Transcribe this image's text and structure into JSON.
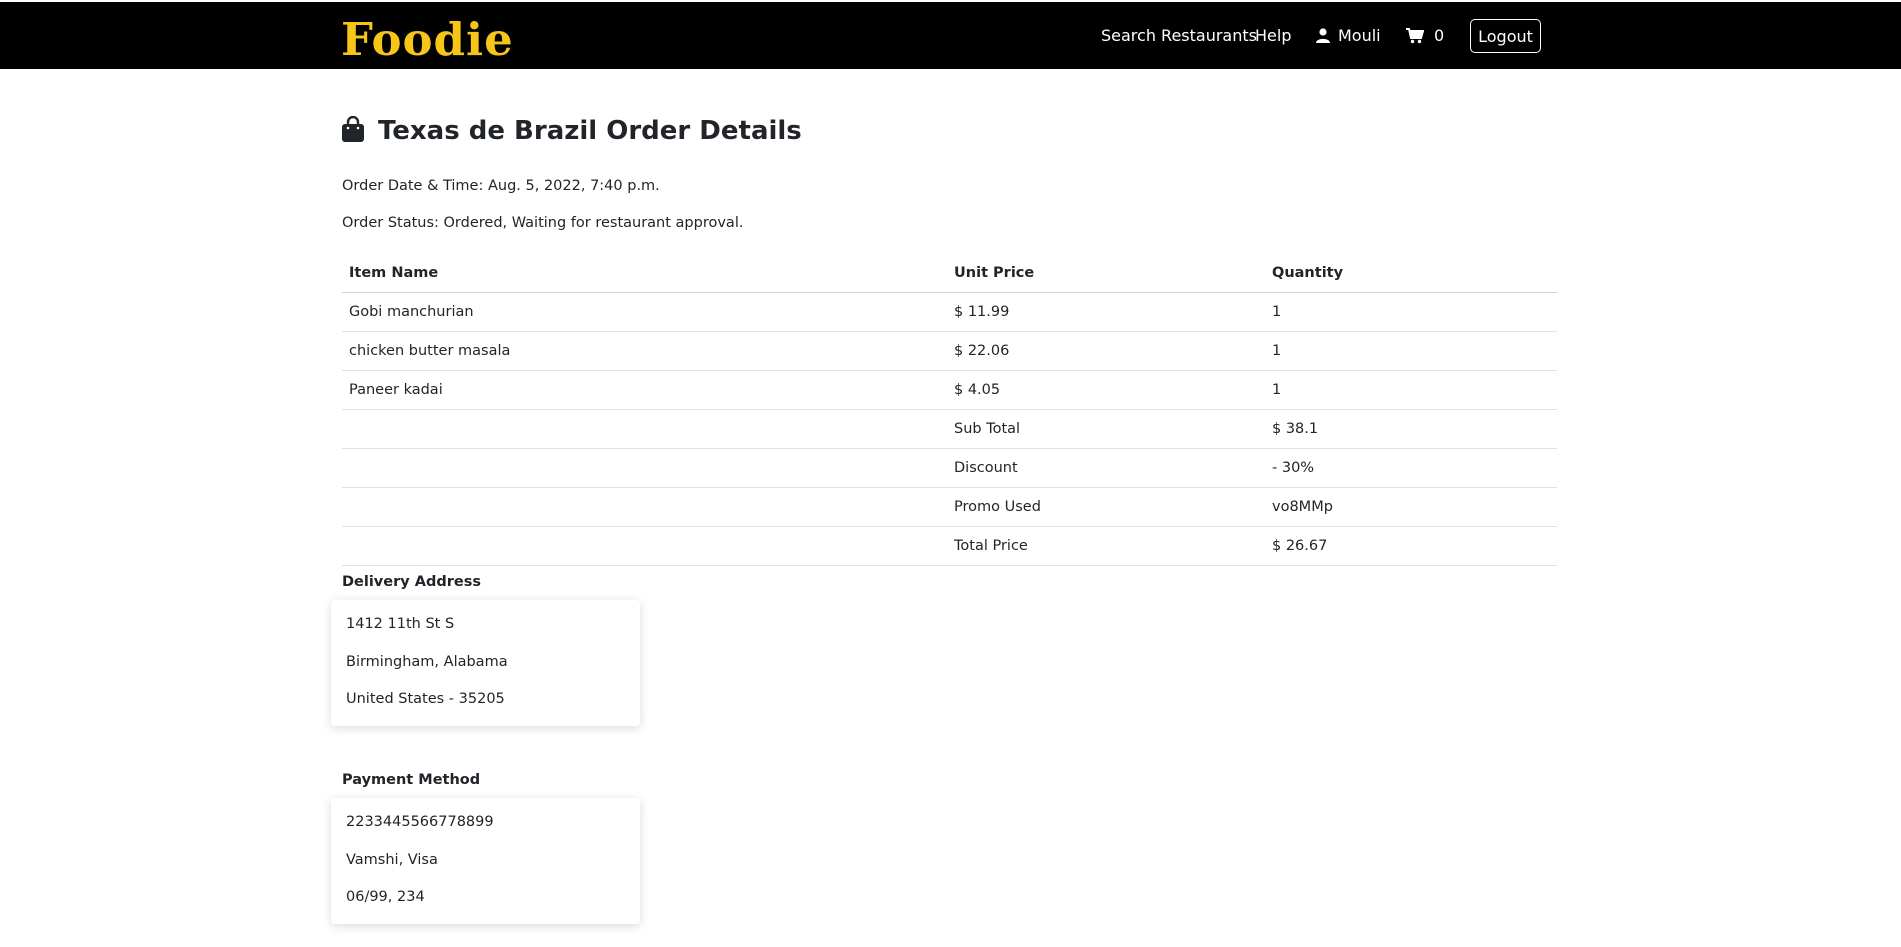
{
  "header": {
    "logo_text": "Foodie",
    "nav": {
      "search_label": "Search Restaurants",
      "help_label": "Help",
      "user_label": "Mouli",
      "cart_count": "0",
      "logout_label": "Logout"
    },
    "icons": {
      "user": "user-icon",
      "cart": "cart-icon"
    },
    "colors": {
      "bar": "#000000",
      "logo": "#f5c518"
    }
  },
  "order": {
    "title": "Texas de Brazil Order Details",
    "icon": "shopping-bag-icon",
    "date_line": "Order Date & Time: Aug. 5, 2022, 7:40 p.m.",
    "status_line": "Order Status: Ordered, Waiting for restaurant approval."
  },
  "table": {
    "headers": [
      "Item Name",
      "Unit Price",
      "Quantity"
    ],
    "rows": [
      [
        "Gobi manchurian",
        "$ 11.99",
        "1"
      ],
      [
        "chicken butter masala",
        "$ 22.06",
        "1"
      ],
      [
        "Paneer kadai",
        "$ 4.05",
        "1"
      ]
    ],
    "summary": [
      [
        "Sub Total",
        "$ 38.1"
      ],
      [
        "Discount",
        "- 30%"
      ],
      [
        "Promo Used",
        "vo8MMp"
      ],
      [
        "Total Price",
        "$ 26.67"
      ]
    ]
  },
  "delivery": {
    "label": "Delivery Address",
    "lines": [
      "1412 11th St S",
      "Birmingham, Alabama",
      "United States - 35205"
    ]
  },
  "payment": {
    "label": "Payment Method",
    "lines": [
      "2233445566778899",
      "Vamshi, Visa",
      "06/99, 234"
    ]
  }
}
